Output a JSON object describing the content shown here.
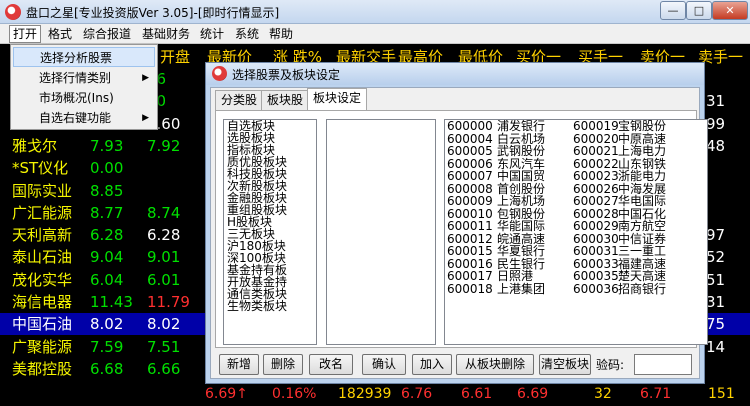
{
  "window": {
    "title": "盘口之星[专业投资版Ver 3.05]-[即时行情显示]",
    "minimize": "—",
    "maximize": "□",
    "close": "✕"
  },
  "menubar": [
    "打开",
    "格式",
    "综合报道",
    "基础财务",
    "统计",
    "系统",
    "帮助"
  ],
  "dropdown": {
    "items": [
      {
        "label": "选择分析股票",
        "submenu": false
      },
      {
        "label": "选择行情类别",
        "submenu": true
      },
      {
        "label": "市场概况(Ins)",
        "submenu": false
      },
      {
        "label": "自选右键功能",
        "submenu": true
      }
    ],
    "arrow": "▶"
  },
  "table": {
    "headers": [
      "开盘",
      "最新价",
      "涨 跌%",
      "最新交手",
      "最高价",
      "最低价",
      "买价一",
      "买手一",
      "卖价一",
      "卖手一"
    ],
    "rows": [
      {
        "name": "",
        "price": "",
        "prev": "76",
        "right": "",
        "color": "#00e000"
      },
      {
        "name": "",
        "price": "",
        "prev": "60",
        "right": "31",
        "color": "#00e000"
      },
      {
        "name": "",
        "price": "",
        "prev": "3.60",
        "right": "99",
        "color": "#ffffff"
      },
      {
        "name": "雅戈尔",
        "price": "7.93",
        "prev": "7.92",
        "right": "48",
        "color": "#00e000"
      },
      {
        "name": "*ST仪化",
        "price": "0.00",
        "prev": "",
        "right": "",
        "color": "#00e000"
      },
      {
        "name": "国际实业",
        "price": "8.85",
        "prev": "",
        "right": "",
        "color": "#00e000"
      },
      {
        "name": "广汇能源",
        "price": "8.77",
        "prev": "8.74",
        "right": "",
        "color": "#00e000"
      },
      {
        "name": "天利高新",
        "price": "6.28",
        "prev": "6.28",
        "right": "97",
        "color": "#00e000"
      },
      {
        "name": "泰山石油",
        "price": "9.04",
        "prev": "9.01",
        "right": "52",
        "color": "#00e000"
      },
      {
        "name": "茂化实华",
        "price": "6.04",
        "prev": "6.01",
        "right": "51",
        "color": "#00e000"
      },
      {
        "name": "海信电器",
        "price": "11.43",
        "prev": "11.79",
        "right": "31",
        "color": "#00e000"
      },
      {
        "name": "中国石油",
        "price": "8.02",
        "prev": "8.02",
        "right": "75",
        "color": "#ffffff"
      },
      {
        "name": "广聚能源",
        "price": "7.59",
        "prev": "7.51",
        "right": "14",
        "color": "#00e000"
      },
      {
        "name": "美都控股",
        "price": "6.68",
        "prev": "6.66",
        "right": "",
        "color": "#00e000"
      }
    ],
    "bottom_row": [
      "6.69↑",
      "0.16%",
      "182939",
      "6.76",
      "6.61",
      "6.69",
      "32",
      "6.71",
      "151"
    ]
  },
  "dialog": {
    "title": "选择股票及板块设定",
    "tabs": [
      "分类股",
      "板块股",
      "板块设定"
    ],
    "blocks": [
      "自选板块",
      "选股板块",
      "指标板块",
      "质优股板块",
      "科技股板块",
      "次新股板块",
      "金融股板块",
      "重组股板块",
      "H股板块",
      "三无板块",
      "沪180板块",
      "深100板块",
      "基金持有板",
      "开放基金持",
      "通信类板块",
      "生物类板块"
    ],
    "stocks": [
      [
        "600000",
        "浦发银行",
        "600019",
        "宝钢股份"
      ],
      [
        "600004",
        "白云机场",
        "600020",
        "中原高速"
      ],
      [
        "600005",
        "武钢股份",
        "600021",
        "上海电力"
      ],
      [
        "600006",
        "东风汽车",
        "600022",
        "山东钢铁"
      ],
      [
        "600007",
        "中国国贸",
        "600023",
        "浙能电力"
      ],
      [
        "600008",
        "首创股份",
        "600026",
        "中海发展"
      ],
      [
        "600009",
        "上海机场",
        "600027",
        "华电国际"
      ],
      [
        "600010",
        "包钢股份",
        "600028",
        "中国石化"
      ],
      [
        "600011",
        "华能国际",
        "600029",
        "南方航空"
      ],
      [
        "600012",
        "皖通高速",
        "600030",
        "中信证券"
      ],
      [
        "600015",
        "华夏银行",
        "600031",
        "三一重工"
      ],
      [
        "600016",
        "民生银行",
        "600033",
        "福建高速"
      ],
      [
        "600017",
        "日照港",
        "600035",
        "楚天高速"
      ],
      [
        "600018",
        "上港集团",
        "600036",
        "招商银行"
      ]
    ],
    "buttons": [
      "新增",
      "删除",
      "改名",
      "确认",
      "加入",
      "从板块删除",
      "清空板块"
    ],
    "password_label": "验码:",
    "password_value": ""
  }
}
